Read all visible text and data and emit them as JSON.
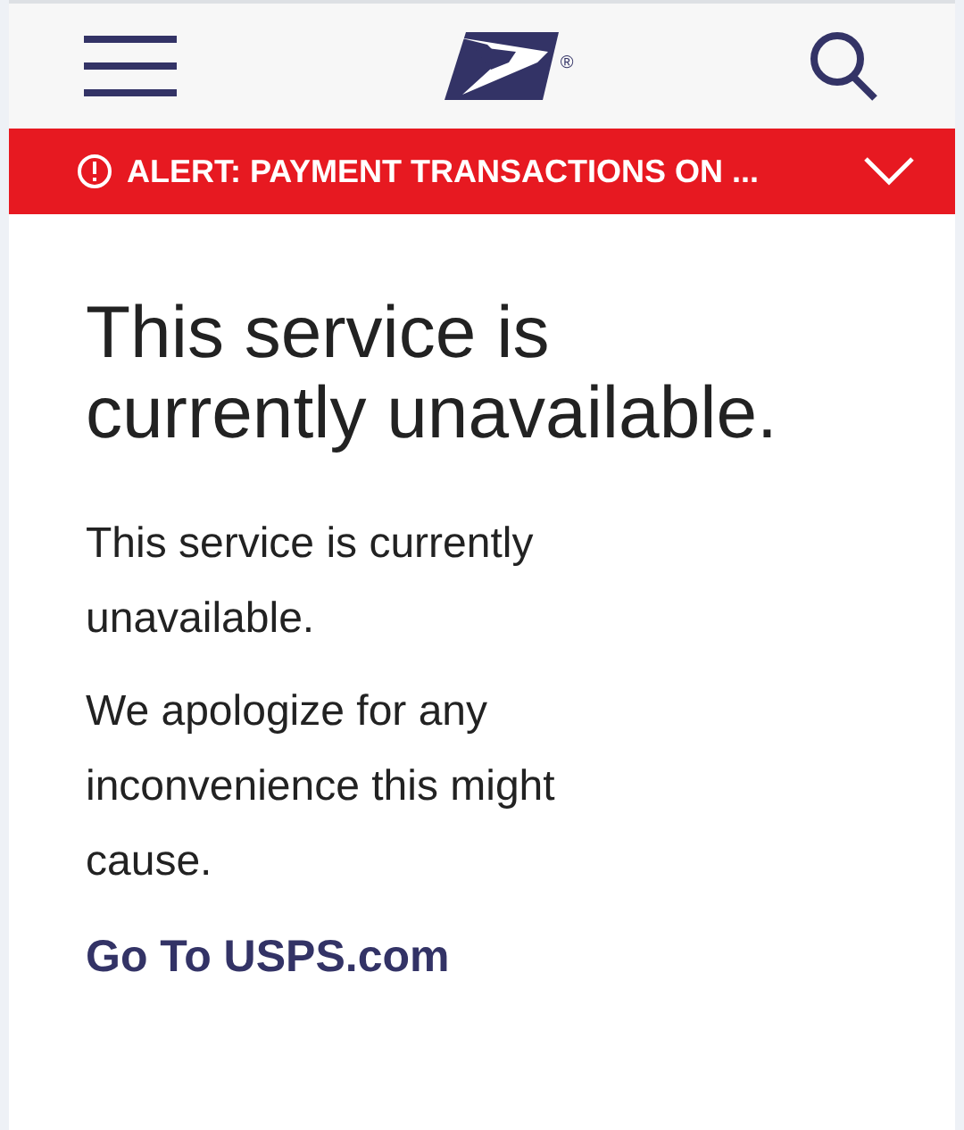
{
  "header": {
    "registered_mark": "®"
  },
  "alert": {
    "text": "ALERT: PAYMENT TRANSACTIONS ON ...",
    "expanded": false
  },
  "heading": "This service is currently unavailable.",
  "paragraphs": [
    "This service is currently unavailable.",
    "We apologize for any inconvenience this might cause."
  ],
  "link": "Go To USPS.com"
}
